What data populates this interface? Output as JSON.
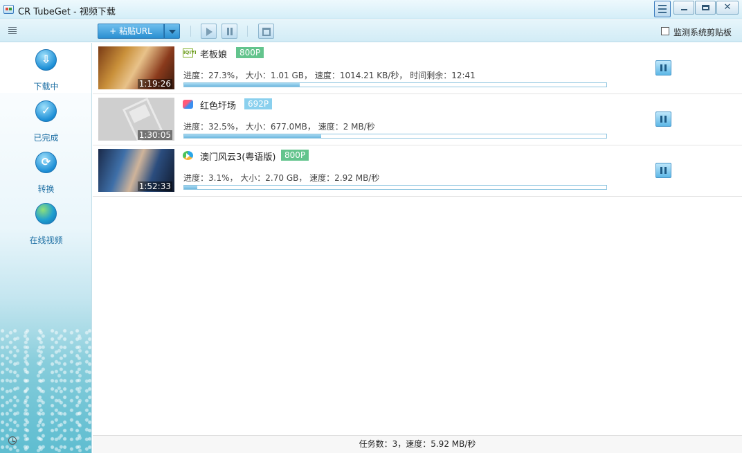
{
  "window": {
    "title": "CR TubeGet - 视频下载",
    "buttons": {
      "menu": "menu-icon",
      "minimize": "minimize-icon",
      "maximize": "maximize-icon",
      "close": "✕"
    }
  },
  "toolbar": {
    "paste_label": "+ 粘贴URL",
    "monitor_clipboard_label": "监测系统剪贴板",
    "monitor_clipboard_checked": false
  },
  "sidebar": {
    "items": [
      {
        "label": "下载中",
        "icon": "download-icon",
        "active": true
      },
      {
        "label": "已完成",
        "icon": "check-icon",
        "active": false
      },
      {
        "label": "转换",
        "icon": "convert-icon",
        "active": false
      },
      {
        "label": "在线视频",
        "icon": "globe-icon",
        "active": false
      }
    ]
  },
  "downloads": [
    {
      "title": "老板娘",
      "quality": "800P",
      "quality_color": "#63c48d",
      "site_icon": "iqiyi-icon",
      "site_text": "iQIYI",
      "duration": "1:19:26",
      "status": "进度：27.3%， 大小：1.01 GB， 速度：1014.21 KB/秒， 时间剩余：12:41",
      "progress": 27.3
    },
    {
      "title": "红色圩场",
      "quality": "692P",
      "quality_color": "#8ad0ee",
      "site_icon": "mgtv-icon",
      "duration": "1:30:05",
      "status": "进度：32.5%， 大小：677.0MB， 速度：2 MB/秒",
      "progress": 32.5
    },
    {
      "title": "澳门风云3(粤语版)",
      "quality": "800P",
      "quality_color": "#63c48d",
      "site_icon": "tencent-video-icon",
      "duration": "1:52:33",
      "status": "进度：3.1%， 大小：2.70 GB， 速度：2.92 MB/秒",
      "progress": 3.1
    }
  ],
  "statusbar": {
    "text": "任务数：3，速度：5.92 MB/秒"
  }
}
